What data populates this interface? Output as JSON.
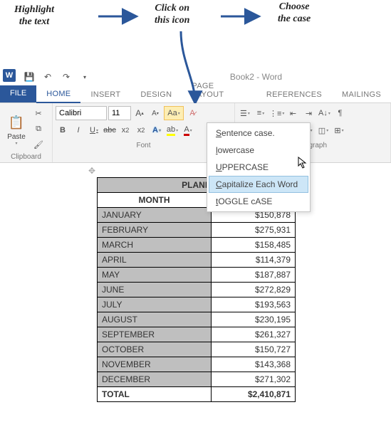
{
  "annotations": {
    "highlight": "Highlight\nthe text",
    "click": "Click on\nthis icon",
    "choose": "Choose\nthe case"
  },
  "titlebar": {
    "doc_title": "Book2 - Word"
  },
  "tabs": {
    "file": "FILE",
    "home": "HOME",
    "insert": "INSERT",
    "design": "DESIGN",
    "layout": "PAGE LAYOUT",
    "references": "REFERENCES",
    "mailings": "MAILINGS"
  },
  "ribbon": {
    "clipboard_label": "Clipboard",
    "paste": "Paste",
    "font_label": "Font",
    "font_name": "Calibri",
    "font_size": "11",
    "paragraph_label": "aragraph",
    "change_case_menu": {
      "sentence": "Sentence case.",
      "lower": "lowercase",
      "upper": "UPPERCASE",
      "capitalize": "Capitalize Each Word",
      "toggle": "tOGGLE cASE"
    }
  },
  "table": {
    "title": "PLANE",
    "col1": "MONTH",
    "col2": "",
    "rows": [
      {
        "m": "JANUARY",
        "v": "$150,878"
      },
      {
        "m": "FEBRUARY",
        "v": "$275,931"
      },
      {
        "m": "MARCH",
        "v": "$158,485"
      },
      {
        "m": "APRIL",
        "v": "$114,379"
      },
      {
        "m": "MAY",
        "v": "$187,887"
      },
      {
        "m": "JUNE",
        "v": "$272,829"
      },
      {
        "m": "JULY",
        "v": "$193,563"
      },
      {
        "m": "AUGUST",
        "v": "$230,195"
      },
      {
        "m": "SEPTEMBER",
        "v": "$261,327"
      },
      {
        "m": "OCTOBER",
        "v": "$150,727"
      },
      {
        "m": "NOVEMBER",
        "v": "$143,368"
      },
      {
        "m": "DECEMBER",
        "v": "$271,302"
      }
    ],
    "total_label": "TOTAL",
    "total_value": "$2,410,871"
  }
}
